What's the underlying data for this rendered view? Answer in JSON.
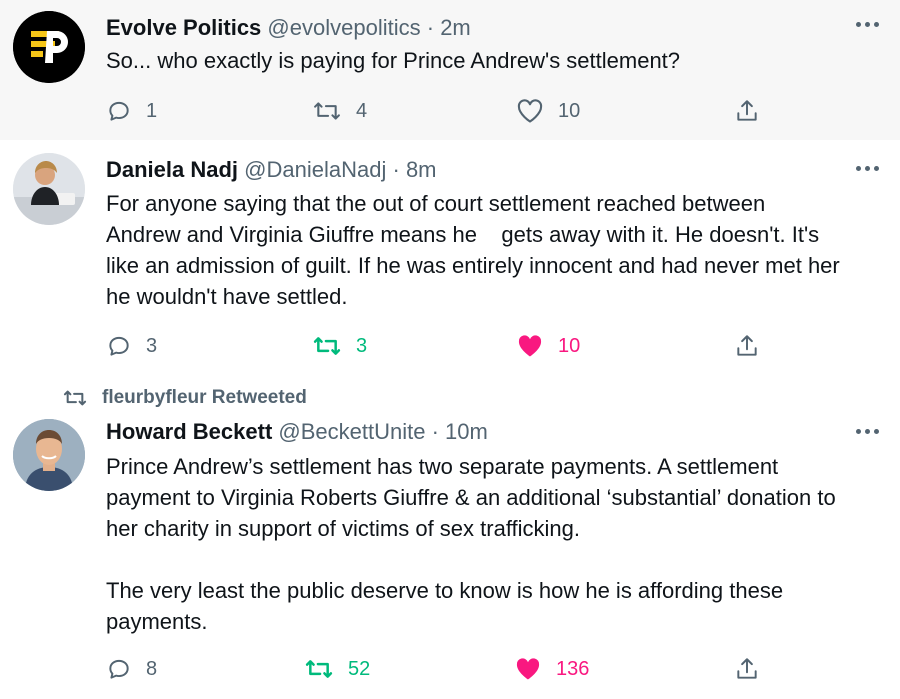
{
  "tweets": [
    {
      "name": "Evolve Politics",
      "handle": "@evolvepolitics",
      "sep": "·",
      "time": "2m",
      "text": "So... who exactly is paying for Prince Andrew's settlement?",
      "replies": "1",
      "retweets": "4",
      "likes": "10",
      "retweeted": false,
      "liked": false,
      "avatar_icon": "evolve-politics-logo"
    },
    {
      "name": "Daniela Nadj",
      "handle": "@DanielaNadj",
      "sep": "·",
      "time": "8m",
      "text": "For anyone saying that the out of court settlement reached between\nAndrew and Virginia Giuffre means he    gets away with it. He doesn't. It's\nlike an admission of guilt. If he was entirely innocent and had never met her\nhe wouldn't have settled.",
      "replies": "3",
      "retweets": "3",
      "likes": "10",
      "retweeted": true,
      "liked": true,
      "avatar_icon": "profile-photo"
    },
    {
      "name": "Howard Beckett",
      "handle": "@BeckettUnite",
      "sep": "·",
      "time": "10m",
      "text": "Prince Andrew’s settlement has two separate payments. A settlement\npayment to Virginia Roberts Giuffre & an additional ‘substantial’ donation to\nher charity in support of victims of sex trafficking.\n\nThe very least the public deserve to know is how he is affording these\npayments.",
      "replies": "8",
      "retweets": "52",
      "likes": "136",
      "retweeted": true,
      "liked": true,
      "avatar_icon": "profile-photo"
    }
  ],
  "retweet_banner": "fleurbyfleur Retweeted",
  "colors": {
    "text": "#0f1419",
    "secondary": "#536471",
    "retweet_green": "#00ba7c",
    "like_pink": "#f91880",
    "highlight_bg": "#f7f7f7",
    "logo_yellow": "#f5c518"
  }
}
